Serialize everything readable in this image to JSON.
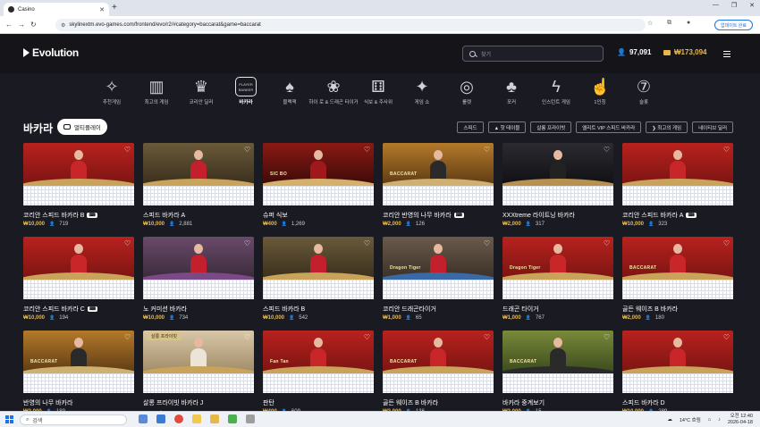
{
  "browser": {
    "tab_title": "Casino",
    "new_tab": "+",
    "url": "skylinextm.evo-games.com/frontend/evo/r2/#category=baccarat&game=baccarat",
    "update_button": "업데이트 완료",
    "window_controls": [
      "—",
      "❐",
      "✕"
    ]
  },
  "header": {
    "logo": "Evolution",
    "search_placeholder": "찾기",
    "players_count": "97,091",
    "balance": "₩173,094"
  },
  "categories": [
    {
      "label": "추천게임",
      "icon": "✧"
    },
    {
      "label": "최고의 게임",
      "icon": "▥"
    },
    {
      "label": "코리안 딜러",
      "icon": "♛"
    },
    {
      "label": "바카라",
      "icon": "PLAYER BANKER",
      "active": true
    },
    {
      "label": "블랙잭",
      "icon": "♠"
    },
    {
      "label": "하이 로 & 드래곤 타이거",
      "icon": "❀"
    },
    {
      "label": "식보 & 주사위",
      "icon": "⚅"
    },
    {
      "label": "게임 쇼",
      "icon": "✦"
    },
    {
      "label": "룰렛",
      "icon": "◎"
    },
    {
      "label": "포커",
      "icon": "♣"
    },
    {
      "label": "인스턴트 게임",
      "icon": "ϟ"
    },
    {
      "label": "1인칭",
      "icon": "☝"
    },
    {
      "label": "슬롯",
      "icon": "⑦"
    }
  ],
  "section": {
    "title": "바카라",
    "multiplay": "멀티플레이"
  },
  "filters": [
    "스피드",
    "▲ 핫 테이블",
    "살롱 프라이빗",
    "엘리트 VIP 스피드 바카라",
    "❯ 최고의 게임",
    "네이티브 딜러"
  ],
  "games": [
    {
      "name": "코리안 스피드 바카라 B",
      "kr": true,
      "stake": "₩10,000",
      "count": "719",
      "theme": "red"
    },
    {
      "name": "스피드 바카라 A",
      "kr": false,
      "stake": "₩10,000",
      "count": "2,881",
      "theme": "gold"
    },
    {
      "name": "슈퍼 식보",
      "kr": false,
      "stake": "₩400",
      "count": "1,269",
      "theme": "sicbo",
      "logo": "SIC BO"
    },
    {
      "name": "코리안 반영의 나무 바카라",
      "kr": true,
      "stake": "₩2,000",
      "count": "126",
      "theme": "amber",
      "logo": "BACCARAT"
    },
    {
      "name": "XXXtreme 라이트닝 바카라",
      "kr": false,
      "stake": "₩2,000",
      "count": "317",
      "theme": "dark"
    },
    {
      "name": "코리안 스피드 바카라 A",
      "kr": true,
      "stake": "₩10,000",
      "count": "323",
      "theme": "red"
    },
    {
      "name": "코리안 스피드 바카라 C",
      "kr": true,
      "stake": "₩10,000",
      "count": "194",
      "theme": "red"
    },
    {
      "name": "노 커미션 바카라",
      "kr": false,
      "stake": "₩10,000",
      "count": "734",
      "theme": "purple"
    },
    {
      "name": "스피드 바카라 B",
      "kr": false,
      "stake": "₩10,000",
      "count": "542",
      "theme": "gold"
    },
    {
      "name": "코리안 드래곤타이거",
      "kr": false,
      "stake": "₩1,000",
      "count": "65",
      "theme": "blue",
      "logo": "Dragon Tiger"
    },
    {
      "name": "드래곤 타이거",
      "kr": false,
      "stake": "₩1,000",
      "count": "767",
      "theme": "red",
      "logo": "Dragon Tiger"
    },
    {
      "name": "골든 웨이즈 B 바카라",
      "kr": false,
      "stake": "₩2,000",
      "count": "180",
      "theme": "red",
      "logo": "BACCARAT"
    },
    {
      "name": "반영의 나무 바카라",
      "kr": false,
      "stake": "₩2,000",
      "count": "189",
      "theme": "amber",
      "logo": "BACCARAT"
    },
    {
      "name": "살롱 프라이빗 바카라 J",
      "kr": false,
      "stake": "₩100만",
      "count": "",
      "theme": "cream",
      "badge": "살롱 프라이빗"
    },
    {
      "name": "판탄",
      "kr": false,
      "stake": "₩400",
      "count": "609",
      "theme": "red",
      "logo": "Fan Tan"
    },
    {
      "name": "골든 웨이즈 B 바카라",
      "kr": false,
      "stake": "₩2,000",
      "count": "136",
      "theme": "red",
      "logo": "BACCARAT"
    },
    {
      "name": "바카라 중계보기",
      "kr": false,
      "stake": "₩2,000",
      "count": "15",
      "theme": "green",
      "logo": "BACCARAT"
    },
    {
      "name": "스피드 바카라 D",
      "kr": false,
      "stake": "₩10,000",
      "count": "289",
      "theme": "red"
    }
  ],
  "taskbar": {
    "search": "검색",
    "weather": "14°C 흐림",
    "time": "오전 12:40",
    "date": "2026-04-18"
  }
}
